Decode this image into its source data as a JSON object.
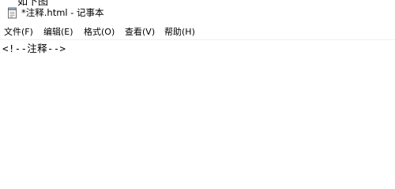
{
  "background_fragment": "如下图",
  "window": {
    "title": "*注释.html - 记事本"
  },
  "menu": {
    "items": [
      {
        "label": "文件(F)"
      },
      {
        "label": "编辑(E)"
      },
      {
        "label": "格式(O)"
      },
      {
        "label": "查看(V)"
      },
      {
        "label": "帮助(H)"
      }
    ]
  },
  "editor": {
    "content": "<!--注释-->"
  },
  "icons": {
    "app": "notepad-icon"
  }
}
